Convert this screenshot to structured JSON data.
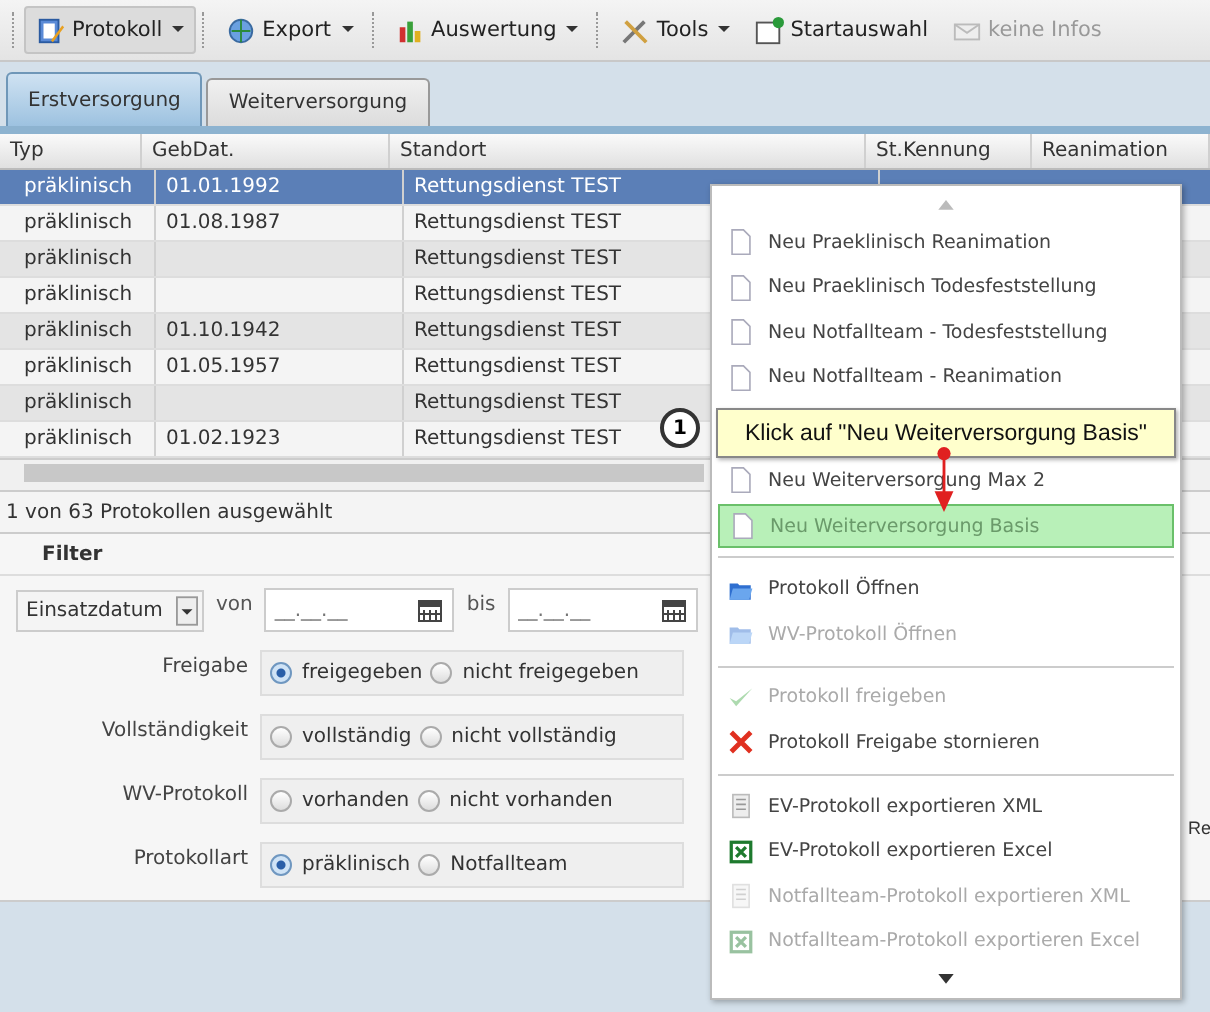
{
  "toolbar": [
    {
      "label": "Protokoll",
      "dropdown": true,
      "selected": true,
      "disabled": false
    },
    {
      "label": "Export",
      "dropdown": true,
      "selected": false,
      "disabled": false
    },
    {
      "label": "Auswertung",
      "dropdown": true,
      "selected": false,
      "disabled": false
    },
    {
      "label": "Tools",
      "dropdown": true,
      "selected": false,
      "disabled": false
    },
    {
      "label": "Startauswahl",
      "dropdown": false,
      "selected": false,
      "disabled": false
    },
    {
      "label": "keine Infos",
      "dropdown": false,
      "selected": false,
      "disabled": true
    }
  ],
  "tabs": [
    {
      "label": "Erstversorgung",
      "selected": true
    },
    {
      "label": "Weiterversorgung",
      "selected": false
    }
  ],
  "table": {
    "columns": [
      "Typ",
      "GebDat.",
      "Standort",
      "St.Kennung",
      "Reanimation"
    ],
    "rows": [
      {
        "cells": [
          "präklinisch",
          "01.01.1992",
          "Rettungsdienst TEST"
        ],
        "selected": true
      },
      {
        "cells": [
          "präklinisch",
          "01.08.1987",
          "Rettungsdienst TEST"
        ],
        "selected": false
      },
      {
        "cells": [
          "präklinisch",
          "",
          "Rettungsdienst TEST"
        ],
        "selected": false
      },
      {
        "cells": [
          "präklinisch",
          "",
          "Rettungsdienst TEST"
        ],
        "selected": false
      },
      {
        "cells": [
          "präklinisch",
          "01.10.1942",
          "Rettungsdienst TEST"
        ],
        "selected": false
      },
      {
        "cells": [
          "präklinisch",
          "01.05.1957",
          "Rettungsdienst TEST"
        ],
        "selected": false
      },
      {
        "cells": [
          "präklinisch",
          "",
          "Rettungsdienst TEST"
        ],
        "selected": false
      },
      {
        "cells": [
          "präklinisch",
          "01.02.1923",
          "Rettungsdienst TEST"
        ],
        "selected": false
      }
    ]
  },
  "status_bar": "1 von 63 Protokollen ausgewählt",
  "filter": {
    "title": "Filter",
    "date_field": "Einsatzdatum",
    "from_label": "von",
    "from_placeholder": "__.__.__",
    "to_label": "bis",
    "to_placeholder": "__.__.__",
    "groups": [
      {
        "label": "Freigabe",
        "options": [
          {
            "label": "freigegeben",
            "selected": true
          },
          {
            "label": "nicht freigegeben",
            "selected": false
          }
        ]
      },
      {
        "label": "Vollständigkeit",
        "options": [
          {
            "label": "vollständig",
            "selected": false
          },
          {
            "label": "nicht vollständig",
            "selected": false
          }
        ]
      },
      {
        "label": "WV-Protokoll",
        "options": [
          {
            "label": "vorhanden",
            "selected": false
          },
          {
            "label": "nicht vorhanden",
            "selected": false
          }
        ]
      },
      {
        "label": "Protokollart",
        "options": [
          {
            "label": "präklinisch",
            "selected": true
          },
          {
            "label": "Notfallteam",
            "selected": false
          }
        ]
      }
    ],
    "side_label": "Re"
  },
  "menu": {
    "items": [
      {
        "kind": "doc",
        "label": "Neu Praeklinisch Reanimation",
        "disabled": false,
        "highlighted": false
      },
      {
        "kind": "doc",
        "label": "Neu Praeklinisch Todesfeststellung",
        "disabled": false,
        "highlighted": false
      },
      {
        "kind": "doc",
        "label": "Neu Notfallteam - Todesfeststellung",
        "disabled": false,
        "highlighted": false
      },
      {
        "kind": "doc",
        "label": "Neu Notfallteam - Reanimation",
        "disabled": false,
        "highlighted": false
      },
      {
        "kind": "hidden"
      },
      {
        "kind": "doc",
        "label": "Neu Weiterversorgung Max 2",
        "disabled": false,
        "highlighted": false
      },
      {
        "kind": "doc",
        "label": "Neu Weiterversorgung Basis",
        "disabled": false,
        "highlighted": true
      },
      {
        "kind": "separator"
      },
      {
        "kind": "folder",
        "label": "Protokoll Öffnen",
        "disabled": false,
        "highlighted": false
      },
      {
        "kind": "folder",
        "label": "WV-Protokoll Öffnen",
        "disabled": true,
        "highlighted": false
      },
      {
        "kind": "separator"
      },
      {
        "kind": "check",
        "label": "Protokoll freigeben",
        "disabled": true,
        "highlighted": false
      },
      {
        "kind": "cross",
        "label": "Protokoll Freigabe stornieren",
        "disabled": false,
        "highlighted": false
      },
      {
        "kind": "separator"
      },
      {
        "kind": "xml",
        "label": "EV-Protokoll exportieren XML",
        "disabled": false,
        "highlighted": false
      },
      {
        "kind": "excel",
        "label": "EV-Protokoll exportieren Excel",
        "disabled": false,
        "highlighted": false
      },
      {
        "kind": "xml",
        "label": "Notfallteam-Protokoll exportieren XML",
        "disabled": true,
        "highlighted": false
      },
      {
        "kind": "excel",
        "label": "Notfallteam-Protokoll exportieren Excel",
        "disabled": true,
        "highlighted": false
      }
    ]
  },
  "callout": {
    "number": "1",
    "text": "Klick auf \"Neu Weiterversorgung Basis\""
  }
}
